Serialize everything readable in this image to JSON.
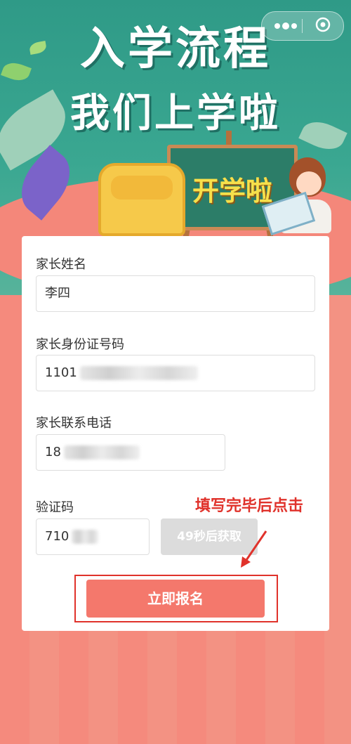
{
  "header": {
    "title_line1": "入学流程",
    "title_line2": "我们上学啦",
    "board_text": "开学啦"
  },
  "form": {
    "parent_name": {
      "label": "家长姓名",
      "value": "李四"
    },
    "parent_id": {
      "label": "家长身份证号码",
      "value_visible": "1101"
    },
    "parent_phone": {
      "label": "家长联系电话",
      "value_visible": "18"
    },
    "code": {
      "label": "验证码",
      "value_visible": "710"
    },
    "get_code_button": "49秒后获取",
    "submit_button": "立即报名"
  },
  "annotation": {
    "text": "填写完毕后点击"
  },
  "colors": {
    "hero_green": "#3aa791",
    "page_pink": "#f4877a",
    "submit_bg": "#f4786c",
    "annotation_red": "#e0322b",
    "disabled_btn": "#dcdcdc"
  },
  "icons": {
    "capsule_left": "more-dots-icon",
    "capsule_right": "target-close-icon"
  }
}
